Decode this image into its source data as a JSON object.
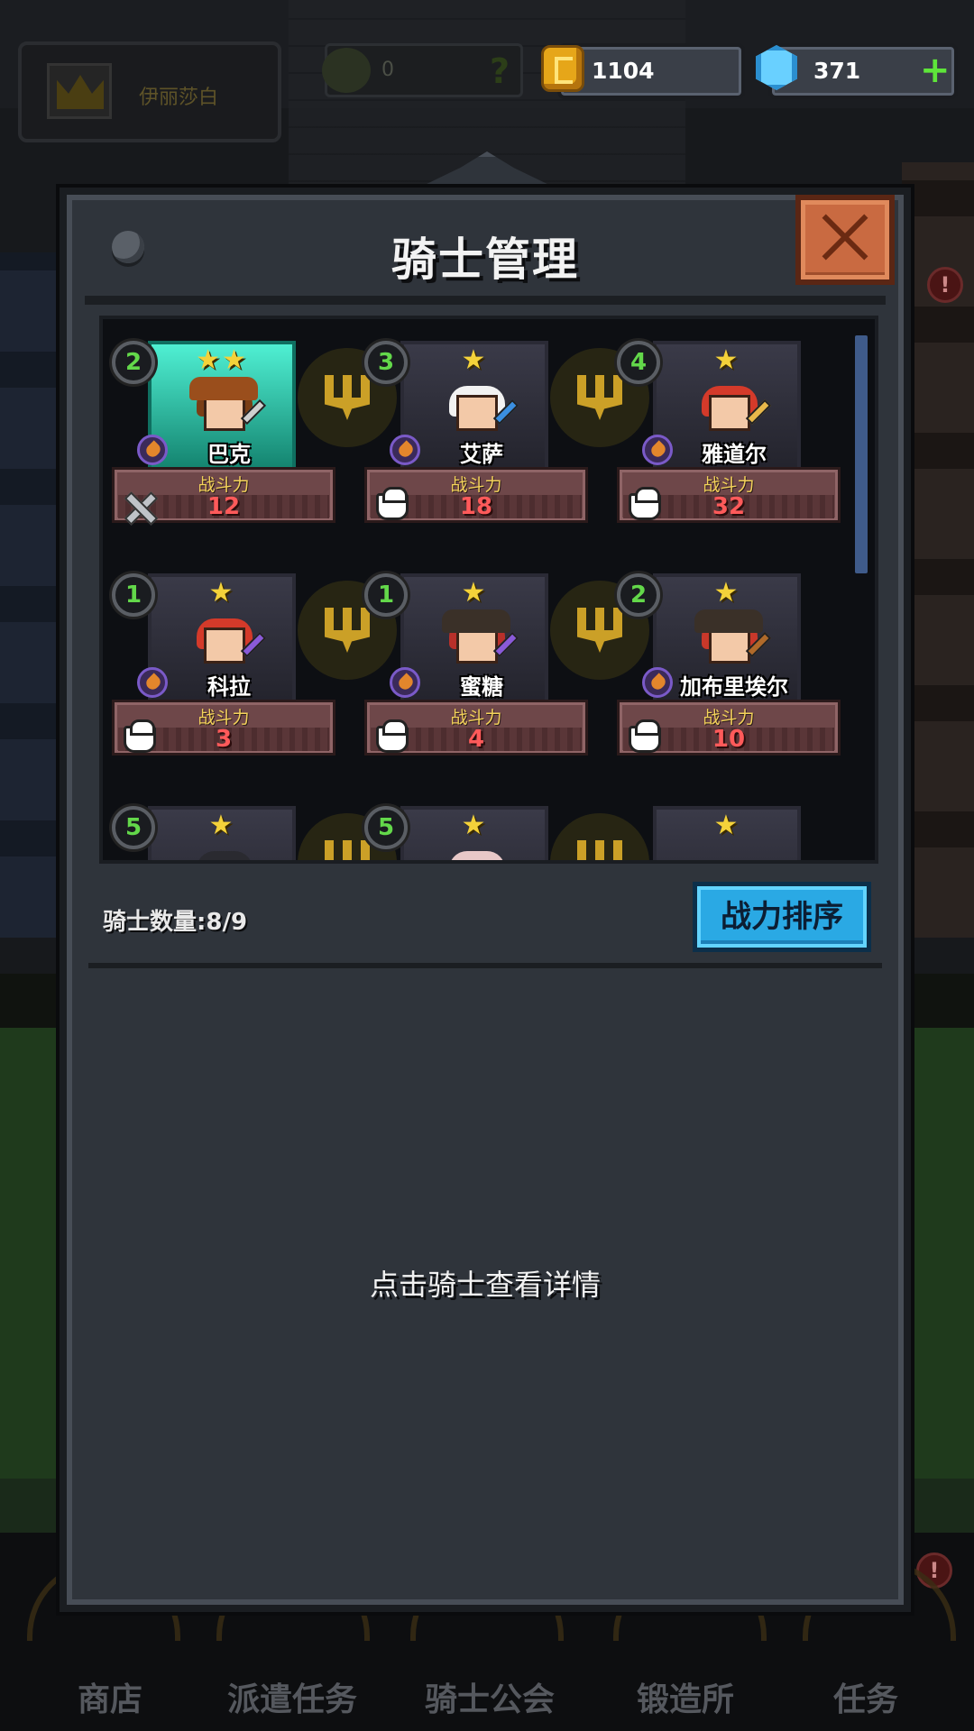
{
  "hud": {
    "player_name": "伊丽莎白",
    "power_value": "0",
    "power_help": "?",
    "gold": "1104",
    "gems": "371",
    "add_symbol": "+"
  },
  "modal": {
    "title": "骑士管理",
    "knight_count_label": "骑士数量:8/9",
    "sort_button": "战力排序",
    "hint": "点击骑士查看详情"
  },
  "power_label": "战斗力",
  "knights": [
    {
      "level": "2",
      "stars": "★★",
      "name": "巴克",
      "power": "12",
      "role": "warrior-icon",
      "selected": true,
      "hair": "#7a3e16",
      "hat": "#9a4e1c",
      "weapon": "#cfcfcf"
    },
    {
      "level": "3",
      "stars": "★",
      "name": "艾萨",
      "power": "18",
      "role": "chef-icon",
      "selected": false,
      "hair": "#f2f2f2",
      "hat": "",
      "weapon": "#3b8fe0"
    },
    {
      "level": "4",
      "stars": "★",
      "name": "雅道尔",
      "power": "32",
      "role": "chef-icon",
      "selected": false,
      "hair": "#d43a2a",
      "hat": "",
      "weapon": "#e8b84a"
    },
    {
      "level": "1",
      "stars": "★",
      "name": "科拉",
      "power": "3",
      "role": "chef-icon",
      "selected": false,
      "hair": "#d43a2a",
      "hat": "",
      "weapon": "#8a5ad8"
    },
    {
      "level": "1",
      "stars": "★",
      "name": "蜜糖",
      "power": "4",
      "role": "chef-icon",
      "selected": false,
      "hair": "#b8302a",
      "hat": "#3a3028",
      "weapon": "#8a5ad8"
    },
    {
      "level": "2",
      "stars": "★",
      "name": "加布里埃尔",
      "power": "10",
      "role": "chef-icon",
      "selected": false,
      "hair": "#c8382a",
      "hat": "#3a3028",
      "weapon": "#b06a2a"
    },
    {
      "level": "5",
      "stars": "★",
      "name": "",
      "power": "",
      "role": "",
      "selected": false,
      "hair": "#2a2a30",
      "hat": "",
      "weapon": ""
    },
    {
      "level": "5",
      "stars": "★",
      "name": "",
      "power": "",
      "role": "",
      "selected": false,
      "hair": "#e8c8c8",
      "hat": "",
      "weapon": ""
    },
    {
      "level": "",
      "stars": "★",
      "name": "",
      "power": "",
      "role": "",
      "selected": false,
      "hair": "",
      "hat": "",
      "weapon": ""
    }
  ],
  "bottom_nav": [
    "商店",
    "派遣任务",
    "骑士公会",
    "锻造所",
    "任务"
  ],
  "alert_mark": "!",
  "colors": {
    "gold": "#e6a619",
    "gem": "#69d0ff",
    "power_value": "#ff5a5a",
    "level_text": "#63d84a",
    "sort_button": "#2aa9e4",
    "close_button": "#c96a41"
  }
}
